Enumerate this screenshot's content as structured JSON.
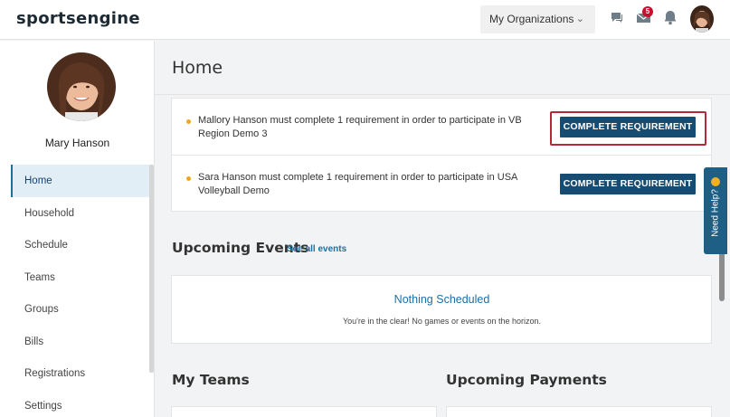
{
  "header": {
    "logo_text": "sportsengine",
    "org_button_label": "My Organizations",
    "chevron_icon": "chevron-down-icon",
    "message_badge": "5",
    "icons": [
      "chat-icon",
      "envelope-icon",
      "bell-icon",
      "avatar"
    ]
  },
  "sidebar": {
    "user_name": "Mary Hanson",
    "items": [
      {
        "label": "Home",
        "active": true
      },
      {
        "label": "Household"
      },
      {
        "label": "Schedule"
      },
      {
        "label": "Teams"
      },
      {
        "label": "Groups"
      },
      {
        "label": "Bills"
      },
      {
        "label": "Registrations"
      },
      {
        "label": "Settings"
      }
    ]
  },
  "main": {
    "title": "Home",
    "requirements": [
      {
        "text": "Mallory Hanson must complete 1 requirement in order to participate in VB Region Demo 3",
        "button_label": "COMPLETE REQUIREMENT"
      },
      {
        "text": "Sara Hanson must complete 1 requirement in order to participate in USA Volleyball Demo",
        "button_label": "COMPLETE REQUIREMENT"
      }
    ],
    "upcoming_events": {
      "title": "Upcoming Events",
      "see_all": "See all events",
      "empty_title": "Nothing Scheduled",
      "empty_subtitle": "You're in the clear! No games or events on the horizon."
    },
    "my_teams_title": "My Teams",
    "upcoming_payments_title": "Upcoming Payments"
  },
  "help_tab": {
    "label": "Need Help?"
  },
  "colors": {
    "primary_button": "#164c72",
    "link": "#1a6fa5",
    "highlight_border": "#b4283a",
    "badge": "#c8102e",
    "bullet": "#f0a71a"
  }
}
